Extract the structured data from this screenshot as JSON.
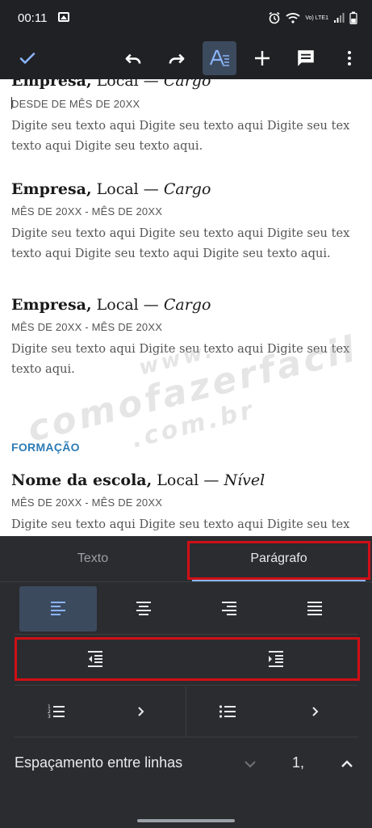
{
  "status_bar": {
    "time": "00:11",
    "network_label": "Vo) LTE1"
  },
  "toolbar": {
    "icons": [
      "check-icon",
      "undo-icon",
      "redo-icon",
      "text-format-icon",
      "add-icon",
      "comment-icon",
      "more-vert-icon"
    ],
    "accent": "#8ab4f8"
  },
  "document": {
    "entries": [
      {
        "company": "Empresa,",
        "location": " Local — ",
        "role": "Cargo",
        "date": "DESDE DE MÊS DE 20XX",
        "body_lines": [
          "Digite seu texto aqui Digite seu texto aqui Digite seu tex",
          "texto aqui Digite seu texto aqui."
        ]
      },
      {
        "company": "Empresa,",
        "location": " Local — ",
        "role": "Cargo",
        "date": "MÊS DE 20XX - MÊS DE 20XX",
        "body_lines": [
          "Digite seu texto aqui Digite seu texto aqui Digite seu tex",
          "texto aqui Digite seu texto aqui Digite seu texto aqui."
        ]
      },
      {
        "company": "Empresa,",
        "location": " Local — ",
        "role": "Cargo",
        "date": "MÊS DE 20XX - MÊS DE 20XX",
        "body_lines": [
          "Digite seu texto aqui Digite seu texto aqui Digite seu tex",
          "texto aqui."
        ]
      }
    ],
    "section_heading": "FORMAÇÃO",
    "school": {
      "name": "Nome da escola,",
      "location": " Local — ",
      "level": "Nível",
      "date": "MÊS DE 20XX - MÊS DE 20XX",
      "body_line": "Digite seu texto aqui Digite seu texto aqui Digite seu tex"
    },
    "watermark": {
      "line1": "www.",
      "line2": "comofazerfacil",
      "line3": ".com.br"
    }
  },
  "format_panel": {
    "tabs": [
      {
        "label": "Texto",
        "active": false
      },
      {
        "label": "Parágrafo",
        "active": true
      }
    ],
    "alignment": {
      "options": [
        "align-left-icon",
        "align-center-icon",
        "align-right-icon",
        "align-justify-icon"
      ],
      "selected": "align-left-icon"
    },
    "indent": [
      "indent-decrease-icon",
      "indent-increase-icon"
    ],
    "lists": [
      "numbered-list-icon",
      "bulleted-list-icon"
    ],
    "line_spacing": {
      "label": "Espaçamento entre linhas",
      "value": "1,"
    },
    "highlight_color": "#d10f16"
  }
}
